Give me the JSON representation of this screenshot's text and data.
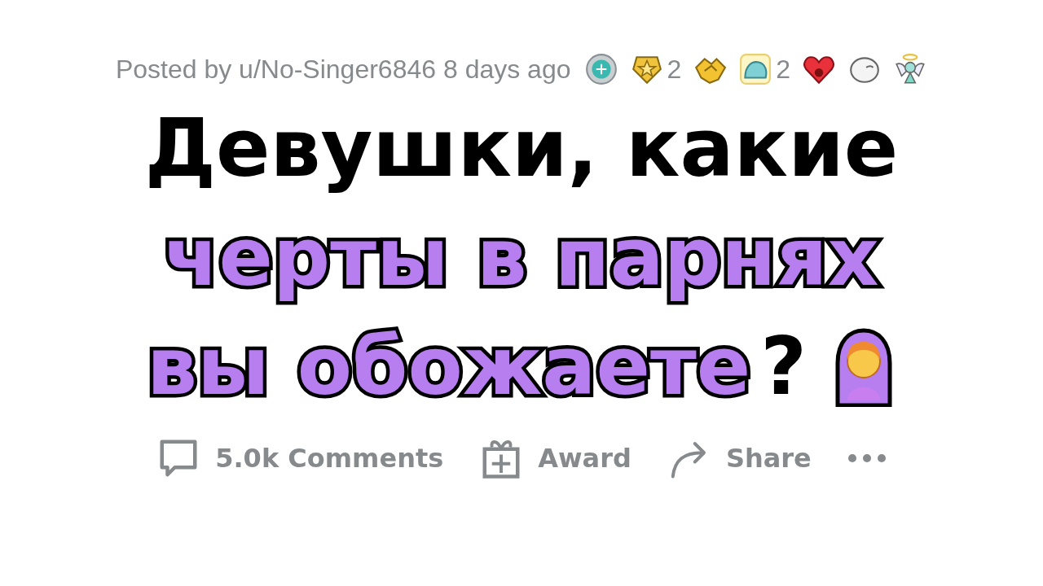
{
  "post_meta": {
    "byline": "Posted by u/No-Singer6846 8 days ago"
  },
  "awards": [
    {
      "kind": "medal"
    },
    {
      "kind": "star",
      "count": "2"
    },
    {
      "kind": "handshake"
    },
    {
      "kind": "blob",
      "count": "2"
    },
    {
      "kind": "heart"
    },
    {
      "kind": "ghost"
    },
    {
      "kind": "angel"
    }
  ],
  "title": {
    "lines": [
      [
        {
          "text": "Девушки, какие",
          "highlighted": false
        }
      ],
      [
        {
          "text": "черты в парнях",
          "highlighted": true
        }
      ],
      [
        {
          "text": "вы обожаете",
          "highlighted": true
        },
        {
          "text": "?",
          "highlighted": false
        }
      ]
    ]
  },
  "actions": [
    {
      "kind": "comments",
      "label": "5.0k Comments"
    },
    {
      "kind": "award",
      "label": "Award"
    },
    {
      "kind": "share",
      "label": "Share"
    }
  ]
}
